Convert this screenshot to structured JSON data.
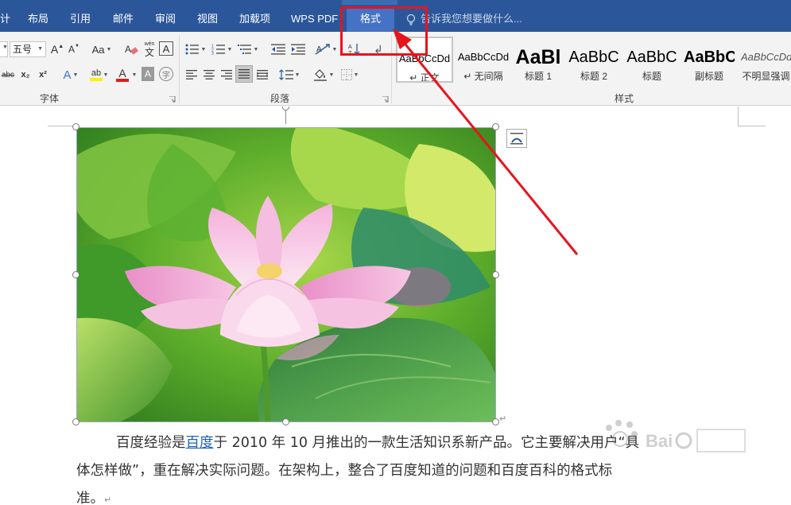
{
  "tabs": [
    {
      "label": "计"
    },
    {
      "label": "布局"
    },
    {
      "label": "引用"
    },
    {
      "label": "邮件"
    },
    {
      "label": "审阅"
    },
    {
      "label": "视图"
    },
    {
      "label": "加载项"
    },
    {
      "label": "WPS PDF"
    },
    {
      "label": "格式",
      "active": true
    }
  ],
  "tell_me": {
    "placeholder": "告诉我您想要做什么..."
  },
  "font_group": {
    "label": "字体",
    "font_size": "五号",
    "change_case": "Aa",
    "phonetic_top": "wén",
    "phonetic_bottom": "文",
    "char_border": "A",
    "strikethrough": "abc",
    "subscript": "x₂",
    "superscript": "x²",
    "grow_font": "A",
    "shrink_font": "A",
    "text_effect": "A",
    "highlight": "ab",
    "font_color": "A",
    "char_shading": "A",
    "enclose": "字"
  },
  "paragraph_group": {
    "label": "段落"
  },
  "styles_group": {
    "label": "样式",
    "items": [
      {
        "preview": "AaBbCcDd",
        "name": "↵ 正文",
        "selected": true
      },
      {
        "preview": "AaBbCcDd",
        "name": "↵ 无间隔"
      },
      {
        "preview": "AaBl",
        "name": "标题 1"
      },
      {
        "preview": "AaBbC",
        "name": "标题 2"
      },
      {
        "preview": "AaBbC",
        "name": "标题"
      },
      {
        "preview": "AaBbC",
        "name": "副标题"
      },
      {
        "preview": "AaBbCcDd",
        "name": "不明显强调"
      }
    ]
  },
  "document": {
    "paragraph": {
      "line1_before": "百度经验是",
      "link": "百度",
      "line1_after": "于 2010 年 10 月推出的一款生活知识系新产品。它主要解决用户“具",
      "line2": "体怎样做”，重在解决实际问题。在架构上，整合了百度知道的问题和百度百科的格式标",
      "line3": "准。",
      "mark": "↵"
    },
    "image_mark": "↵"
  },
  "colors": {
    "title_bar": "#2b579a",
    "active_tab": "#4472c4",
    "annotation": "#e8141b",
    "link": "#1f5fbf"
  }
}
